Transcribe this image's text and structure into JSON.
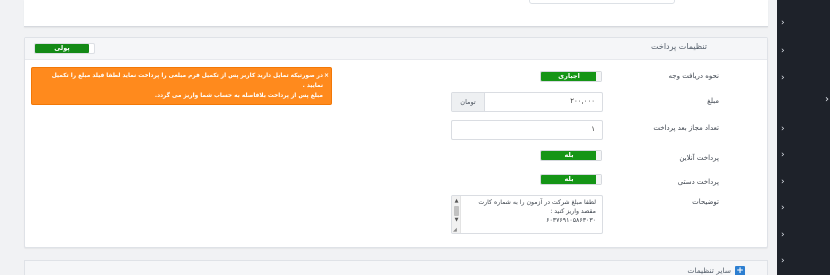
{
  "top_section": {
    "input_value": ""
  },
  "payment_settings": {
    "title": "تنظیمات پرداخت",
    "header_toggle": "پولی",
    "alert": {
      "close": "×",
      "line1": "در صورتیکه تمایل دارید کاربر پس از تکمیل فرم مبلغی را پرداخت نماید لطفا فیلد مبلغ را تکمیل نمایید .",
      "line2": "مبلغ پس از پرداخت بلافاصله به حساب شما واریز می گردد."
    },
    "fields": {
      "payment_method": {
        "label": "نحوه دریافت وجه",
        "value": "اجباری"
      },
      "amount": {
        "label": "مبلغ",
        "value": "۲۰۰,۰۰۰",
        "currency": "تومان"
      },
      "payment_count": {
        "label": "تعداد مجاز بعد پرداخت",
        "value": "۱"
      },
      "online_payment": {
        "label": "پرداخت آنلاین",
        "value": "بله"
      },
      "manual_payment": {
        "label": "پرداخت دستی",
        "value": "بله"
      },
      "description": {
        "label": "توضیحات",
        "line1": "لطفا مبلغ شرکت در آزمون را به شماره کارت",
        "line2": "مقصد واریز کنید :",
        "line3": "۶۰۳۷۶۹۱۰۵۸۶۳۰۳۰"
      }
    }
  },
  "other_settings": {
    "title": "سایر تنظیمات"
  },
  "sidebar": {
    "arrow": "›"
  },
  "colors": {
    "sidebar": "#1e222a",
    "toggle_on": "#159516",
    "alert": "#ff8a1d",
    "plus": "#2d7fd1"
  }
}
